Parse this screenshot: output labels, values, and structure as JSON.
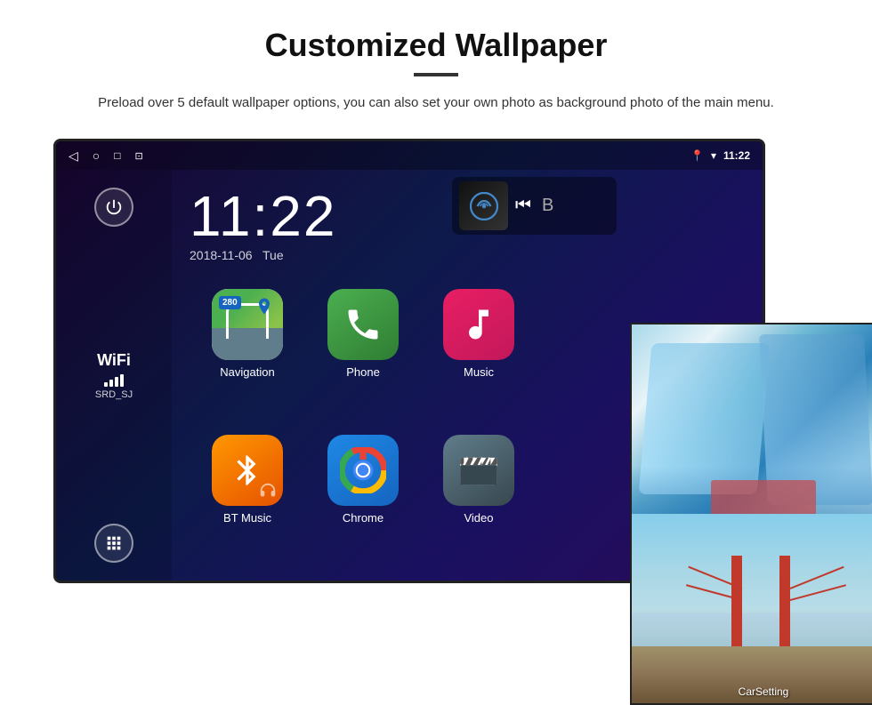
{
  "page": {
    "title": "Customized Wallpaper",
    "description": "Preload over 5 default wallpaper options, you can also set your own photo as background photo of the main menu."
  },
  "android": {
    "time": "11:22",
    "date": "2018-11-06",
    "day": "Tue",
    "wifi_name": "SRD_SJ",
    "wifi_label": "WiFi",
    "apps": [
      {
        "label": "Navigation",
        "icon": "navigation"
      },
      {
        "label": "Phone",
        "icon": "phone"
      },
      {
        "label": "Music",
        "icon": "music"
      },
      {
        "label": "BT Music",
        "icon": "bt-music"
      },
      {
        "label": "Chrome",
        "icon": "chrome"
      },
      {
        "label": "Video",
        "icon": "video"
      }
    ],
    "carsetting_label": "CarSetting"
  }
}
